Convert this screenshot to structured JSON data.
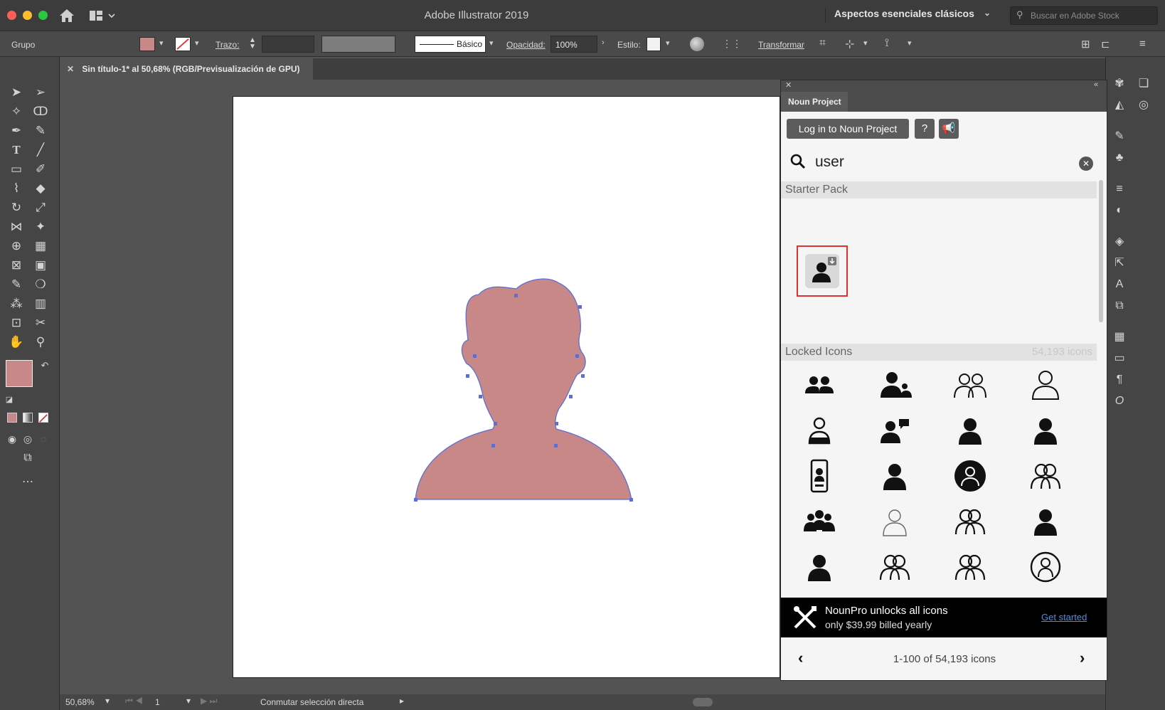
{
  "app": {
    "title": "Adobe Illustrator 2019",
    "workspace": "Aspectos esenciales clásicos",
    "stock_search_placeholder": "Buscar en Adobe Stock"
  },
  "control_bar": {
    "selection_type": "Grupo",
    "fill_color": "#c98888",
    "stroke_label": "Trazo:",
    "brush_label": "Básico",
    "opacity_label": "Opacidad:",
    "opacity_value": "100%",
    "style_label": "Estilo:",
    "transform_label": "Transformar"
  },
  "document": {
    "tab_title": "Sin título-1* al 50,68% (RGB/Previsualización de GPU)",
    "shape_fill": "#c98888",
    "path_color": "#5b6fd6"
  },
  "status": {
    "zoom": "50,68%",
    "artboard_number": "1",
    "tool_hint": "Conmutar selección directa"
  },
  "noun_project": {
    "tab_label": "Noun Project",
    "login_button": "Log in to Noun Project",
    "help_icon": "question-icon",
    "announce_icon": "megaphone-icon",
    "search_value": "user",
    "starter_section": "Starter Pack",
    "locked_section": "Locked Icons",
    "locked_count": "54,193 icons",
    "icons": [
      [
        "two-users-icon",
        "user-plus-icon",
        "users-outline-icon",
        "user-outline-icon"
      ],
      [
        "user-badge-icon",
        "user-chat-icon",
        "user-icon",
        "user-icon"
      ],
      [
        "phone-user-icon",
        "user-icon",
        "user-circle-icon",
        "users-pair-icon"
      ],
      [
        "group-icon",
        "user-thin-icon",
        "users-pair-icon",
        "user-icon"
      ],
      [
        "user-icon",
        "users-pair-icon",
        "users-pair-icon",
        "user-circle-outline-icon"
      ]
    ],
    "promo_title": "NounPro unlocks all icons",
    "promo_sub": "only $39.99 billed yearly",
    "promo_link": "Get started",
    "pager_text": "1-100 of 54,193 icons",
    "highlight_color": "#e03030"
  }
}
